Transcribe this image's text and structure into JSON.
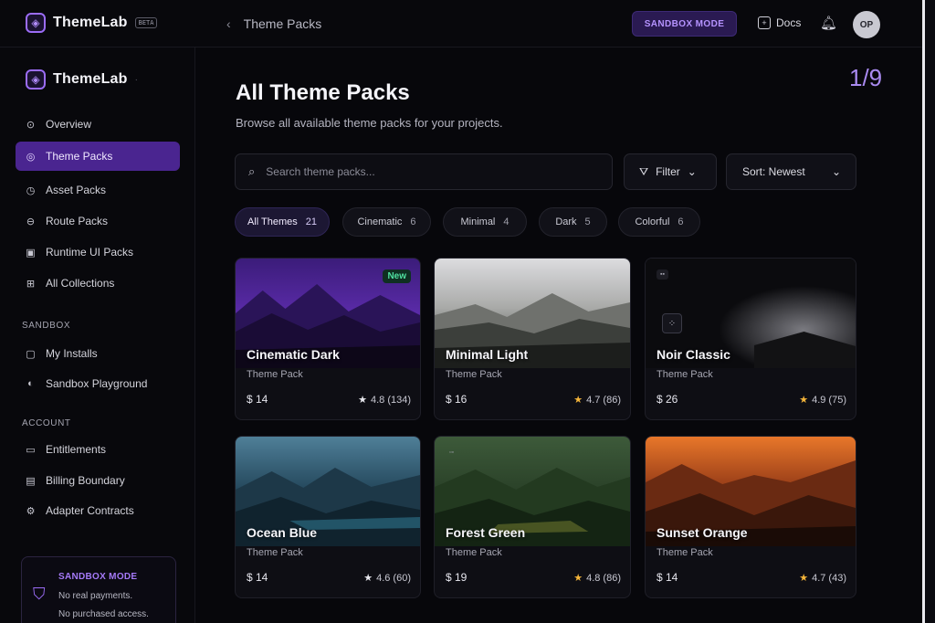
{
  "topbar": {
    "brand": "ThemeLab",
    "brand_chip": "BETA",
    "breadcrumb": "Theme Packs",
    "sandbox_button": "SANDBOX MODE",
    "docs_label": "Docs",
    "avatar_initials": "OP"
  },
  "sidebar": {
    "brand": "ThemeLab",
    "items": [
      {
        "label": "Overview",
        "icon": "overview-icon"
      },
      {
        "label": "Theme Packs",
        "icon": "palette-icon",
        "active": true
      },
      {
        "label": "Asset Packs",
        "icon": "asset-icon"
      },
      {
        "label": "Route Packs",
        "icon": "route-icon"
      },
      {
        "label": "Runtime UI Packs",
        "icon": "runtime-icon"
      },
      {
        "label": "All Collections",
        "icon": "collections-icon"
      }
    ],
    "sandbox_heading": "SANDBOX",
    "sandbox_items": [
      {
        "label": "My Installs",
        "icon": "installs-icon"
      },
      {
        "label": "Sandbox Playground",
        "icon": "playground-icon"
      }
    ],
    "account_heading": "ACCOUNT",
    "account_items": [
      {
        "label": "Entitlements",
        "icon": "entitlements-icon"
      },
      {
        "label": "Billing Boundary",
        "icon": "billing-icon"
      },
      {
        "label": "Adapter Contracts",
        "icon": "adapter-icon"
      }
    ],
    "sandbox_card": {
      "title": "SANDBOX MODE",
      "line1": "No real payments.",
      "line2": "No purchased access."
    }
  },
  "main": {
    "title": "All Theme Packs",
    "subtitle": "Browse all available theme packs for your projects.",
    "counter": "1/9",
    "search_placeholder": "Search theme packs...",
    "filter_label": "Filter",
    "sort_label": "Sort: Newest",
    "chips": [
      {
        "label": "All Themes",
        "count": "21",
        "active": true
      },
      {
        "label": "Cinematic",
        "count": "6"
      },
      {
        "label": "Minimal",
        "count": "4"
      },
      {
        "label": "Dark",
        "count": "5"
      },
      {
        "label": "Colorful",
        "count": "6"
      }
    ],
    "cards": [
      {
        "title": "Cinematic Dark",
        "subtitle": "Theme Pack",
        "price": "$ 14",
        "rating": "4.8 (134)",
        "badge": "New"
      },
      {
        "title": "Minimal Light",
        "subtitle": "Theme Pack",
        "price": "$ 16",
        "rating": "4.7 (86)"
      },
      {
        "title": "Noir Classic",
        "subtitle": "Theme Pack",
        "price": "$ 26",
        "rating": "4.9 (75)"
      },
      {
        "title": "Ocean Blue",
        "subtitle": "Theme Pack",
        "price": "$ 14",
        "rating": "4.6 (60)"
      },
      {
        "title": "Forest Green",
        "subtitle": "Theme Pack",
        "price": "$ 19",
        "rating": "4.8 (86)"
      },
      {
        "title": "Sunset Orange",
        "subtitle": "Theme Pack",
        "price": "$ 14",
        "rating": "4.7 (43)"
      }
    ]
  },
  "colors": {
    "accent": "#9b6cf6",
    "active_nav": "#4a2590",
    "star": "#f5b53a",
    "new_badge": "#4fe0a0"
  }
}
